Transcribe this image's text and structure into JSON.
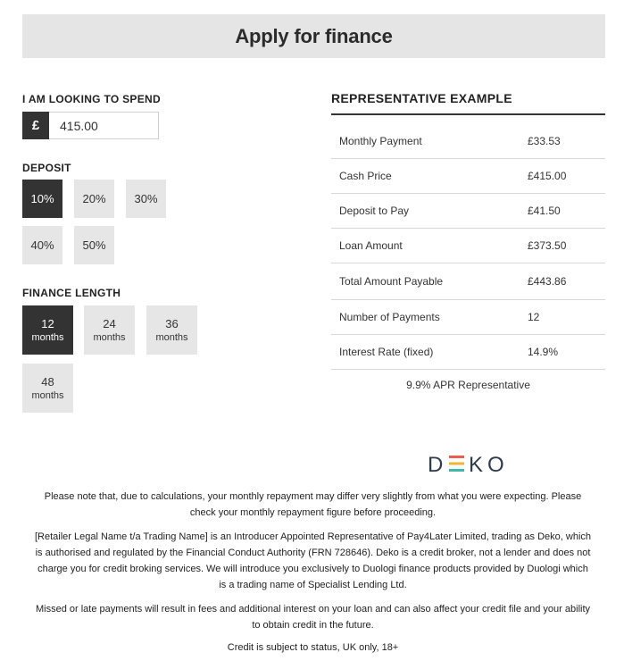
{
  "header": {
    "title": "Apply for finance"
  },
  "spend": {
    "label": "I AM LOOKING TO SPEND",
    "currency_symbol": "£",
    "value": "415.00"
  },
  "deposit": {
    "label": "DEPOSIT",
    "options": [
      "10%",
      "20%",
      "30%",
      "40%",
      "50%"
    ],
    "selected": "10%"
  },
  "finance_length": {
    "label": "FINANCE LENGTH",
    "options": [
      {
        "number": "12",
        "unit": "months"
      },
      {
        "number": "24",
        "unit": "months"
      },
      {
        "number": "36",
        "unit": "months"
      },
      {
        "number": "48",
        "unit": "months"
      }
    ],
    "selected": "12"
  },
  "representative": {
    "title": "REPRESENTATIVE EXAMPLE",
    "rows": [
      {
        "label": "Monthly Payment",
        "value": "£33.53"
      },
      {
        "label": "Cash Price",
        "value": "£415.00"
      },
      {
        "label": "Deposit to Pay",
        "value": "£41.50"
      },
      {
        "label": "Loan Amount",
        "value": "£373.50"
      },
      {
        "label": "Total Amount Payable",
        "value": "£443.86"
      },
      {
        "label": "Number of Payments",
        "value": "12"
      },
      {
        "label": "Interest Rate (fixed)",
        "value": "14.9%"
      }
    ],
    "apr": "9.9% APR Representative"
  },
  "logo": {
    "letters": [
      "D",
      "E",
      "K",
      "O"
    ],
    "colors": {
      "dark": "#2f3a4a",
      "bar1": "#e8604c",
      "bar2": "#f2b533",
      "bar3": "#3cb9a8"
    }
  },
  "notes": {
    "calc": "Please note that, due to calculations, your monthly repayment may differ very slightly from what you were expecting. Please check your monthly repayment figure before proceeding.",
    "legal": "[Retailer Legal Name t/a Trading Name] is an Introducer Appointed Representative of Pay4Later Limited, trading as Deko, which is authorised and regulated by the Financial Conduct Authority (FRN 728646). Deko is a credit broker, not a lender and does not charge you for credit broking services. We will introduce you exclusively to Duologi finance products provided by Duologi which is a trading name of Specialist Lending Ltd.",
    "missed": "Missed or late payments will result in fees and additional interest on your loan and can also affect your credit file and your ability to obtain credit in the future.",
    "status": "Credit is subject to status, UK only, 18+"
  }
}
